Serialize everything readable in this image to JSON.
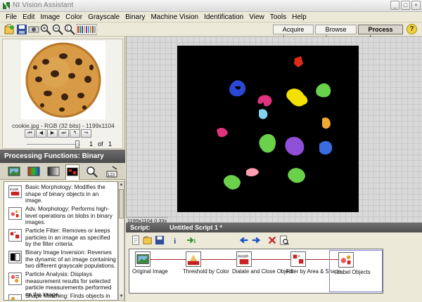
{
  "window": {
    "title": "NI Vision Assistant",
    "controls": [
      "_",
      "□",
      "×"
    ]
  },
  "menu": [
    "File",
    "Edit",
    "Image",
    "Color",
    "Grayscale",
    "Binary",
    "Machine Vision",
    "Identification",
    "View",
    "Tools",
    "Help"
  ],
  "modes": {
    "acquire": "Acquire Images",
    "browse": "Browse Images",
    "process": "Process Images"
  },
  "help_label": "?",
  "thumbnail": {
    "caption": "cookie.jpg - RGB (32 bits) - 1199x1104",
    "page": "1",
    "of_label": "of",
    "total": "1"
  },
  "nav": [
    "⏮",
    "◀",
    "▶",
    "⏭",
    "↰",
    "↪"
  ],
  "processing": {
    "header": "Processing Functions: Binary",
    "functions": [
      {
        "icon": "basic-morphology-icon",
        "text": "Basic Morphology: Modifies the shape of binary objects in an image."
      },
      {
        "icon": "adv-morphology-icon",
        "text": "Adv. Morphology: Performs high-level operations on blobs in binary images."
      },
      {
        "icon": "particle-filter-icon",
        "text": "Particle Filter: Removes or keeps particles in an image as specified by the filter criteria."
      },
      {
        "icon": "binary-inversion-icon",
        "text": "Binary Image Inversion: Reverses the dynamic of an image containing two different grayscale populations."
      },
      {
        "icon": "particle-analysis-icon",
        "text": "Particle Analysis: Displays measurement results for selected particle measurements performed on the image."
      },
      {
        "icon": "shape-matching-icon",
        "text": "Shape Matching: Finds objects in an image that are shaped like the object specified by the template."
      }
    ]
  },
  "viewer": {
    "status": "1199x1104 0.33x"
  },
  "script": {
    "label": "Script:",
    "name": "Untitled Script 1 *",
    "steps": [
      {
        "label": "Original Image",
        "icon": "original-image-icon"
      },
      {
        "label": "Threshold by Color",
        "icon": "threshold-icon"
      },
      {
        "label": "Dialate and Close Object",
        "icon": "morphology-icon"
      },
      {
        "label": "Filter by Area & Shape",
        "icon": "filter-icon"
      },
      {
        "label": "Label Objects",
        "icon": "label-objects-icon"
      }
    ],
    "selected_step": 4
  },
  "colors": {
    "blobs": [
      "#e02818",
      "#2b47d6",
      "#e0337d",
      "#7fd3f0",
      "#f2e000",
      "#6ad24a",
      "#e06aa0",
      "#8f4fd6",
      "#f0a830",
      "#3a6ce0",
      "#ff9fb0"
    ]
  }
}
